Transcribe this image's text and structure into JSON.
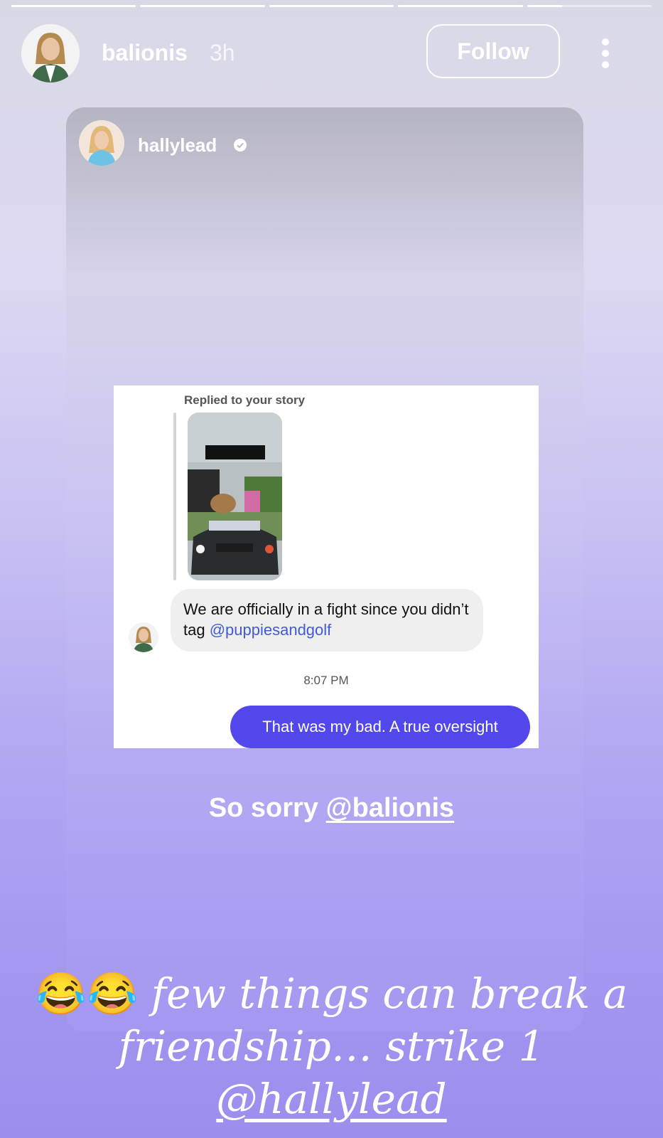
{
  "progress": {
    "segments": 5,
    "active_index": 4,
    "active_fraction": 0.28
  },
  "header": {
    "username": "balionis",
    "time": "3h",
    "follow_label": "Follow",
    "avatar_icon": "profile-photo",
    "more_icon": "more-vertical-icon"
  },
  "reshared_post": {
    "username": "hallylead",
    "verified_icon": "verified-badge-icon",
    "screenshot": {
      "replied_label": "Replied to your story",
      "incoming_message_prefix": "We are officially in a fight since you didn’t tag ",
      "incoming_mention": "@puppiesandgolf",
      "timestamp": "8:07 PM",
      "outgoing_message": "That was my bad. A true oversight"
    },
    "sticker_prefix": "So sorry ",
    "sticker_mention": "@balionis"
  },
  "caption": {
    "emojis": "😂😂",
    "text": " few things can break a friendship… strike 1 ",
    "mention": "@hallylead"
  },
  "colors": {
    "accent": "#5247ea",
    "mention": "#3f5bd8"
  }
}
